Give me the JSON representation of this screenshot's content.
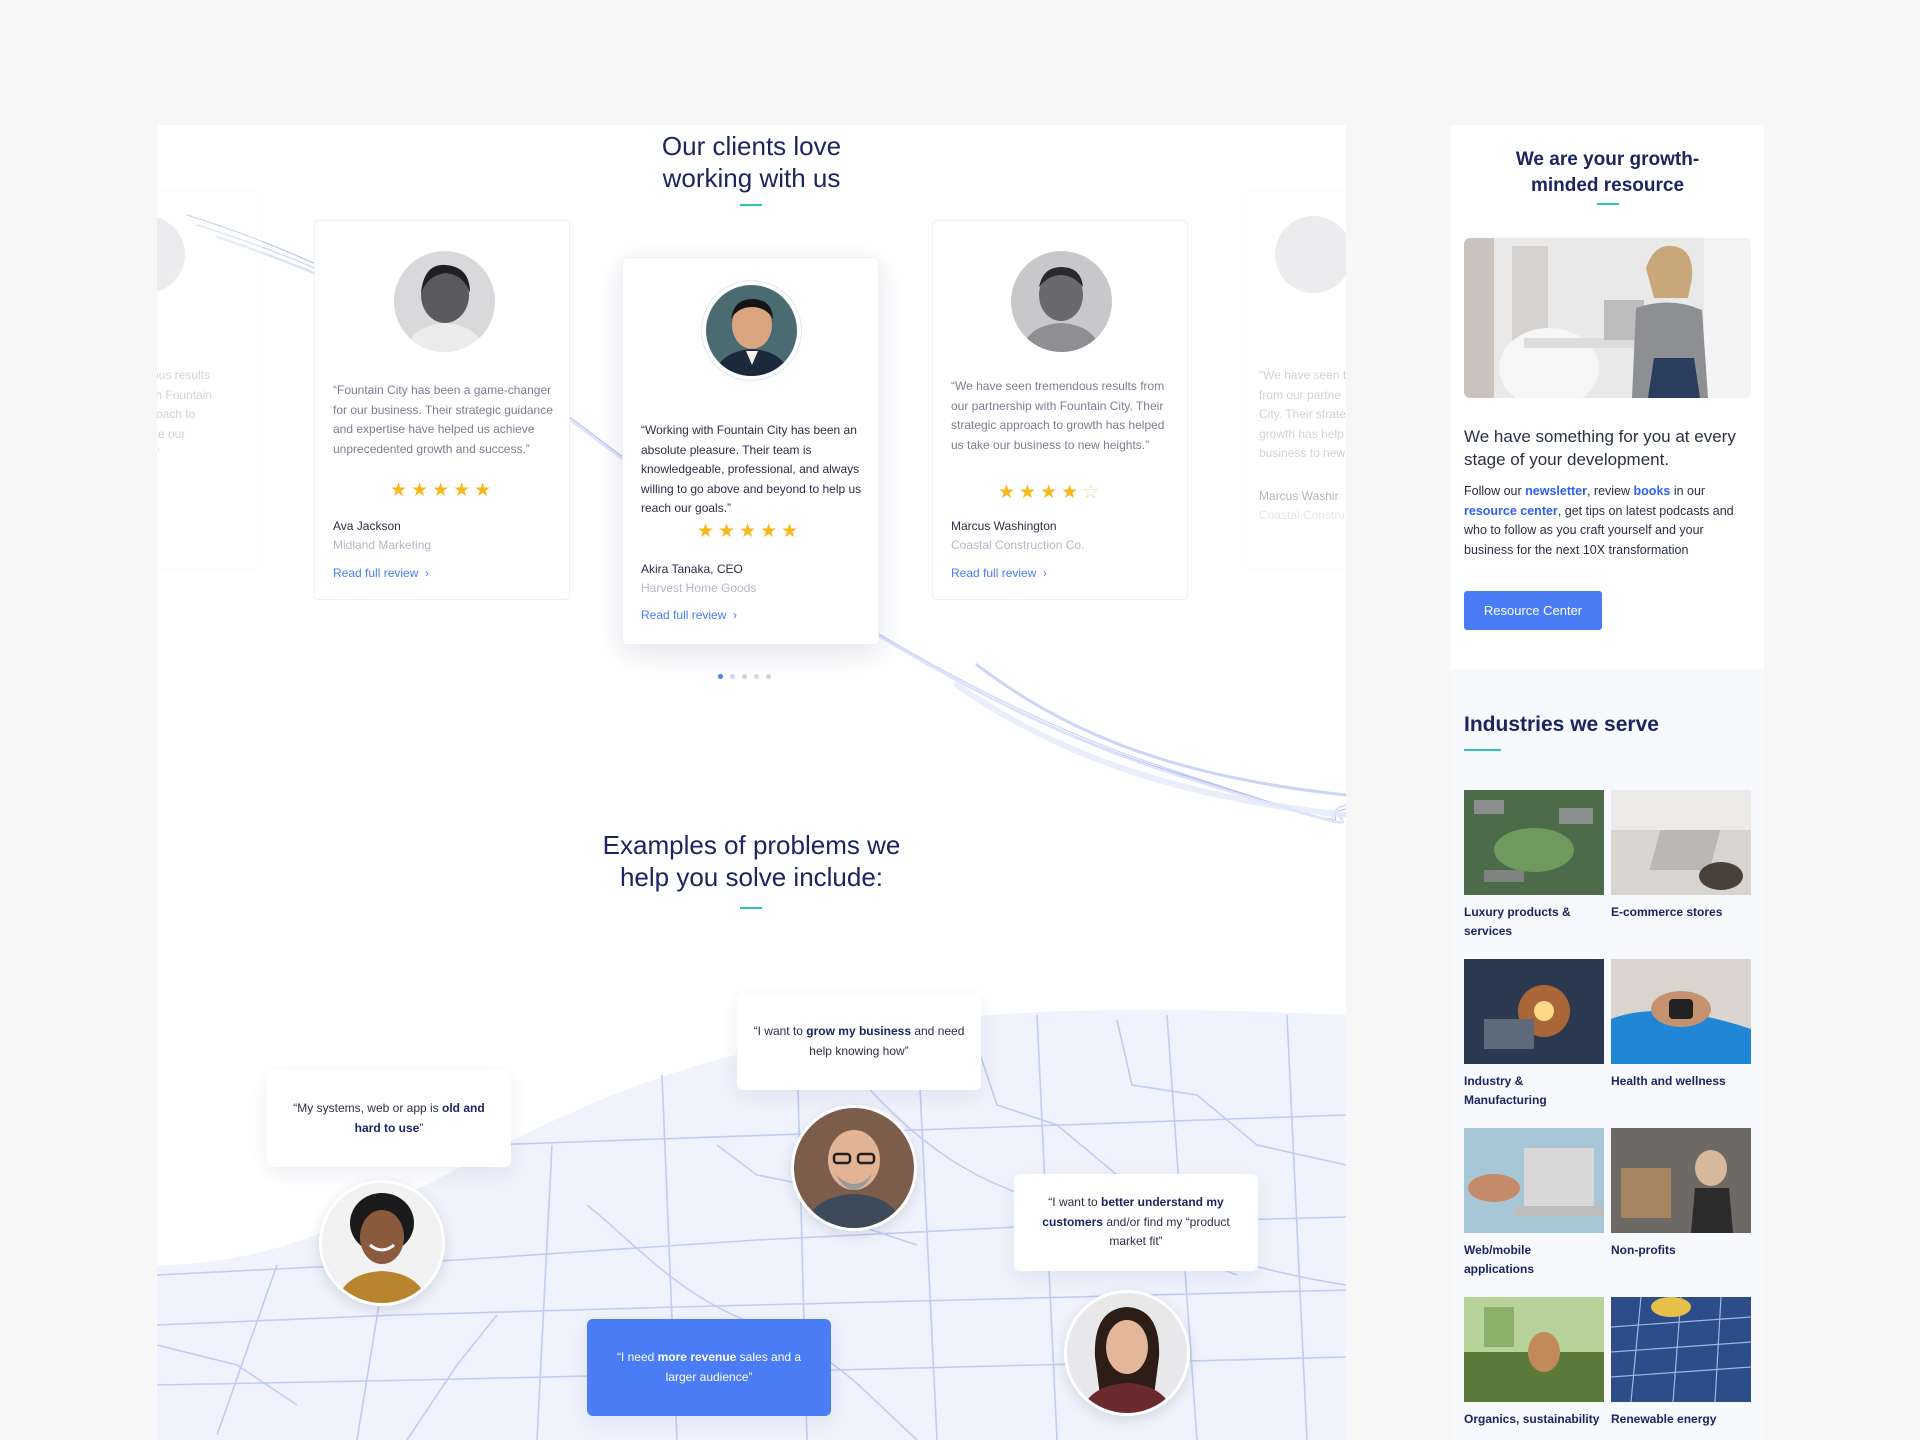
{
  "testimonials": {
    "heading_line1": "Our clients love",
    "heading_line2": "working with us",
    "partial_left": {
      "quote_fragment": "ous results\nth Fountain\nroach to\nke our\n.\""
    },
    "cards": [
      {
        "quote": "“Fountain City has been a game-changer for our business. Their strategic guidance and expertise have helped us achieve unprecedented growth and success.”",
        "rating": 4.5,
        "stars_text": "★★★★★",
        "name": "Ava Jackson",
        "company": "Midland Marketing",
        "link": "Read full review"
      },
      {
        "quote": "“Working with Fountain City has been an absolute pleasure. Their team is knowledgeable, professional, and always willing to go above and beyond to help us reach our goals.”",
        "rating": 5,
        "stars_text": "★★★★★",
        "name": "Akira Tanaka, CEO",
        "company": "Harvest Home Goods",
        "link": "Read full review"
      },
      {
        "quote": "“We have seen tremendous results from our partnership with Fountain City. Their strategic approach to growth has helped us take our business to new heights.”",
        "rating": 4,
        "stars_text": "★★★★",
        "star_empty": "☆",
        "name": "Marcus Washington",
        "company": "Coastal Construction Co.",
        "link": "Read full review"
      }
    ],
    "partial_right": {
      "quote_fragment": "“We have seen t\nfrom our partne\nCity. Their strate\ngrowth has help\nbusiness to new",
      "name": "Marcus Washir",
      "company": "Coastal Constru"
    },
    "active_dot": 0,
    "dot_count": 5
  },
  "problems": {
    "heading_line1": "Examples of problems we",
    "heading_line2": "help you solve include:",
    "bubbles": [
      {
        "pre": "“I want to ",
        "bold": "grow my business",
        "post": " and need help knowing how”"
      },
      {
        "pre": "“My systems, web or app is ",
        "bold": "old and hard to use",
        "post": "”"
      },
      {
        "pre": "“I want to ",
        "bold": "better understand my customers",
        "post": " and/or find my “product market fit”"
      },
      {
        "pre": "“I need ",
        "bold": "more revenue",
        "post": " sales and a larger audience”"
      }
    ]
  },
  "sidebar": {
    "title_line1": "We are your growth-",
    "title_line2": "minded resource",
    "lead": "We have something for you at every stage of your development.",
    "body": {
      "t1": "Follow our ",
      "link1": "newsletter",
      "t2": ", review ",
      "link2": "books",
      "t3": " in our ",
      "link3": "resource center",
      "t4": ", get tips on latest podcasts and who to follow as you craft yourself and your business for the next 10X transformation"
    },
    "button": "Resource Center",
    "industries_title": "Industries we serve",
    "industries": [
      {
        "label": "Luxury products & services"
      },
      {
        "label": "E-commerce stores"
      },
      {
        "label": "Industry & Manufacturing"
      },
      {
        "label": "Health and wellness"
      },
      {
        "label": "Web/mobile applications"
      },
      {
        "label": "Non-profits"
      },
      {
        "label": "Organics, sustainability"
      },
      {
        "label": "Renewable energy"
      }
    ]
  }
}
